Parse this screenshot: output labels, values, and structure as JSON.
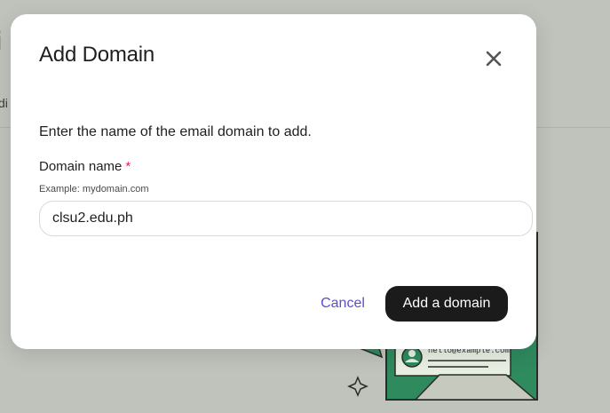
{
  "background": {
    "title_fragment": "i",
    "subtitle_fragment": "di",
    "illustration": {
      "email_text": "hello@example.com",
      "icon_names": [
        "envelope-icon",
        "avatar-icon",
        "sparkle-icon"
      ]
    }
  },
  "modal": {
    "title": "Add Domain",
    "close_icon": "close-icon",
    "instruction": "Enter the name of the email domain to add.",
    "field": {
      "label": "Domain name",
      "required_marker": "*",
      "hint": "Example: mydomain.com",
      "value": "clsu2.edu.ph"
    },
    "buttons": {
      "cancel": "Cancel",
      "submit": "Add a domain"
    }
  },
  "colors": {
    "backdrop": "#bfc3bc",
    "primary_button": "#1b1b1b",
    "cancel_link": "#5a4fc8",
    "required": "#e0245e",
    "illustration_green": "#2f8a5e"
  }
}
